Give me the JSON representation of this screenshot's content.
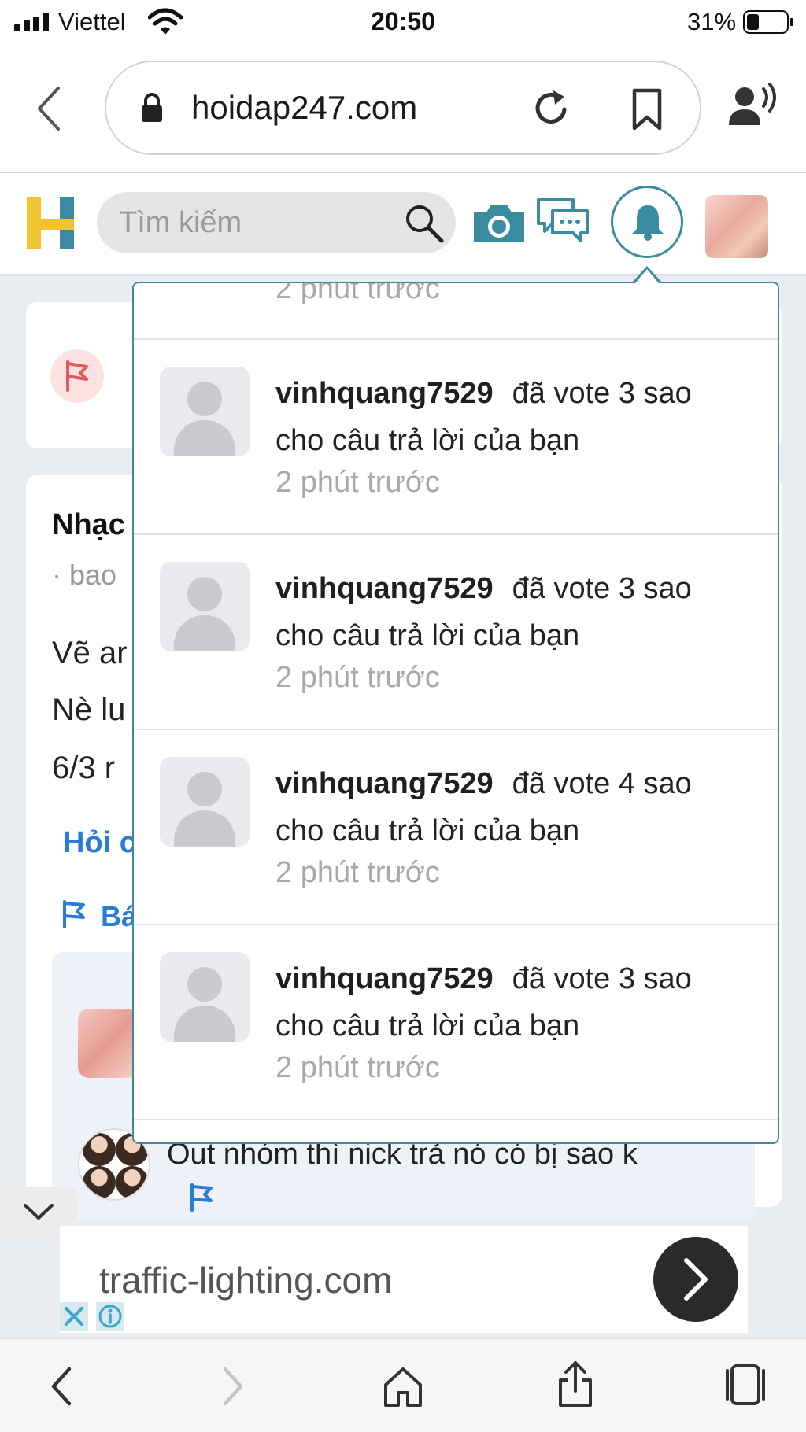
{
  "status_bar": {
    "carrier": "Viettel",
    "time": "20:50",
    "battery_percent": "31%",
    "battery_level": 0.31
  },
  "browser": {
    "url": "hoidap247.com",
    "icons": [
      "back-icon",
      "lock-icon",
      "reload-icon",
      "bookmark-icon",
      "speaker-icon"
    ]
  },
  "site_header": {
    "logo_letter": "H",
    "search_placeholder": "Tìm kiếm",
    "icons": [
      "search-icon",
      "camera-icon",
      "chat-icon",
      "bell-icon"
    ]
  },
  "background_page": {
    "title_fragment": "Nhạc",
    "meta_fragment": "· bao",
    "body_lines": [
      "Vẽ ar",
      "Nè lu",
      "6/3 r"
    ],
    "ask_link_fragment": "Hỏi c",
    "report_fragment": "Bá",
    "reply_text": "Out nhóm thì nick trả nó có bị sao k"
  },
  "notifications": {
    "previous_time": "2 phút trước",
    "items": [
      {
        "user": "vinhquang7529",
        "action": "đã vote 3 sao",
        "message": "cho câu trả lời của bạn",
        "time": "2 phút trước"
      },
      {
        "user": "vinhquang7529",
        "action": "đã vote 3 sao",
        "message": "cho câu trả lời của bạn",
        "time": "2 phút trước"
      },
      {
        "user": "vinhquang7529",
        "action": "đã vote 4 sao",
        "message": "cho câu trả lời của bạn",
        "time": "2 phút trước"
      },
      {
        "user": "vinhquang7529",
        "action": "đã vote 3 sao",
        "message": "cho câu trả lời của bạn",
        "time": "2 phút trước"
      }
    ]
  },
  "ad": {
    "domain": "traffic-lighting.com",
    "close_label": "✕",
    "info_label": "ⓘ"
  },
  "colors": {
    "accent_teal": "#3a8aa0",
    "logo_yellow": "#f2c230",
    "link_blue": "#2a7bd6"
  }
}
